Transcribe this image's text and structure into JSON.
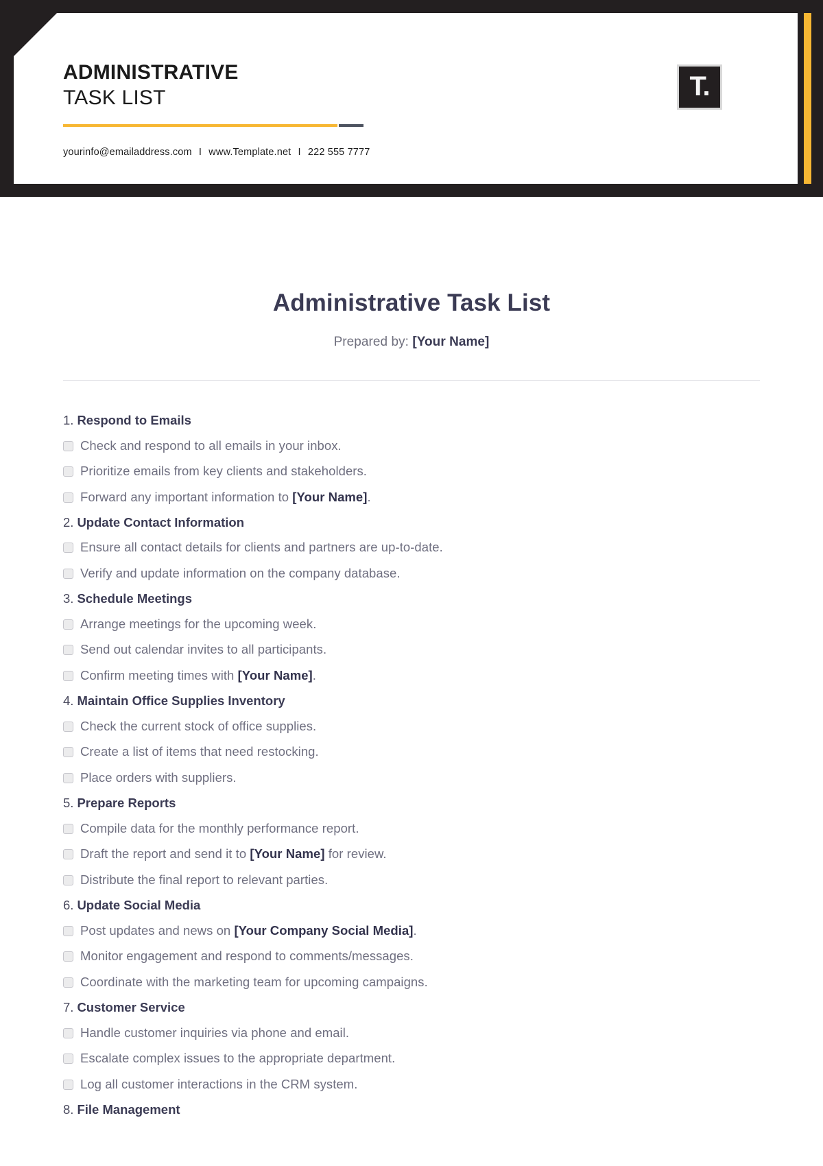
{
  "letterhead": {
    "title_line1": "ADMINISTRATIVE",
    "title_line2": "TASK LIST",
    "contact_email": "yourinfo@emailaddress.com",
    "contact_website": "www.Template.net",
    "contact_phone": "222 555 7777",
    "separator": "I",
    "logo_glyph": "T.",
    "accent_color": "#f7b733",
    "band_color": "#231f20"
  },
  "document": {
    "title": "Administrative Task List",
    "prepared_by_label": "Prepared by:",
    "prepared_by_value": "[Your Name]",
    "sections": [
      {
        "number": "1.",
        "label": "Respond to Emails",
        "tasks": [
          [
            {
              "t": "Check and respond to all emails in your inbox.",
              "b": false
            }
          ],
          [
            {
              "t": "Prioritize emails from key clients and stakeholders.",
              "b": false
            }
          ],
          [
            {
              "t": "Forward any important information to ",
              "b": false
            },
            {
              "t": "[Your Name]",
              "b": true
            },
            {
              "t": ".",
              "b": false
            }
          ]
        ]
      },
      {
        "number": "2.",
        "label": "Update Contact Information",
        "tasks": [
          [
            {
              "t": "Ensure all contact details for clients and partners are up-to-date.",
              "b": false
            }
          ],
          [
            {
              "t": "Verify and update information on the company database.",
              "b": false
            }
          ]
        ]
      },
      {
        "number": "3.",
        "label": "Schedule Meetings",
        "tasks": [
          [
            {
              "t": "Arrange meetings for the upcoming week.",
              "b": false
            }
          ],
          [
            {
              "t": "Send out calendar invites to all participants.",
              "b": false
            }
          ],
          [
            {
              "t": "Confirm meeting times with ",
              "b": false
            },
            {
              "t": "[Your Name]",
              "b": true
            },
            {
              "t": ".",
              "b": false
            }
          ]
        ]
      },
      {
        "number": "4.",
        "label": "Maintain Office Supplies Inventory",
        "tasks": [
          [
            {
              "t": "Check the current stock of office supplies.",
              "b": false
            }
          ],
          [
            {
              "t": "Create a list of items that need restocking.",
              "b": false
            }
          ],
          [
            {
              "t": "Place orders with suppliers.",
              "b": false
            }
          ]
        ]
      },
      {
        "number": "5.",
        "label": "Prepare Reports",
        "tasks": [
          [
            {
              "t": "Compile data for the monthly performance report.",
              "b": false
            }
          ],
          [
            {
              "t": "Draft the report and send it to ",
              "b": false
            },
            {
              "t": "[Your Name]",
              "b": true
            },
            {
              "t": " for review.",
              "b": false
            }
          ],
          [
            {
              "t": "Distribute the final report to relevant parties.",
              "b": false
            }
          ]
        ]
      },
      {
        "number": "6.",
        "label": "Update Social Media",
        "tasks": [
          [
            {
              "t": "Post updates and news on ",
              "b": false
            },
            {
              "t": "[Your Company Social Media]",
              "b": true
            },
            {
              "t": ".",
              "b": false
            }
          ],
          [
            {
              "t": "Monitor engagement and respond to comments/messages.",
              "b": false
            }
          ],
          [
            {
              "t": "Coordinate with the marketing team for upcoming campaigns.",
              "b": false
            }
          ]
        ]
      },
      {
        "number": "7.",
        "label": "Customer Service",
        "tasks": [
          [
            {
              "t": "Handle customer inquiries via phone and email.",
              "b": false
            }
          ],
          [
            {
              "t": "Escalate complex issues to the appropriate department.",
              "b": false
            }
          ],
          [
            {
              "t": "Log all customer interactions in the CRM system.",
              "b": false
            }
          ]
        ]
      },
      {
        "number": "8.",
        "label": "File Management",
        "tasks": []
      }
    ]
  }
}
